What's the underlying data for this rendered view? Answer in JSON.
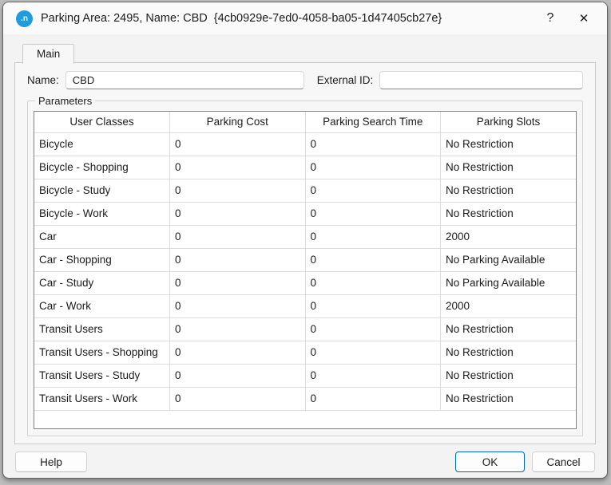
{
  "window": {
    "title": "Parking Area: 2495, Name: CBD  {4cb0929e-7ed0-4058-ba05-1d47405cb27e}",
    "app_icon_text": ".n",
    "help_glyph": "?",
    "close_glyph": "✕"
  },
  "tabs": [
    {
      "label": "Main",
      "active": true
    }
  ],
  "form": {
    "name_label": "Name:",
    "name_value": "CBD",
    "external_id_label": "External ID:",
    "external_id_value": ""
  },
  "parameters": {
    "group_label": "Parameters",
    "table": {
      "columns": [
        "User Classes",
        "Parking Cost",
        "Parking Search Time",
        "Parking Slots"
      ],
      "rows": [
        [
          "Bicycle",
          "0",
          "0",
          "No Restriction"
        ],
        [
          "Bicycle - Shopping",
          "0",
          "0",
          "No Restriction"
        ],
        [
          "Bicycle - Study",
          "0",
          "0",
          "No Restriction"
        ],
        [
          "Bicycle - Work",
          "0",
          "0",
          "No Restriction"
        ],
        [
          "Car",
          "0",
          "0",
          "2000"
        ],
        [
          "Car - Shopping",
          "0",
          "0",
          "No Parking Available"
        ],
        [
          "Car - Study",
          "0",
          "0",
          "No Parking Available"
        ],
        [
          "Car - Work",
          "0",
          "0",
          "2000"
        ],
        [
          "Transit Users",
          "0",
          "0",
          "No Restriction"
        ],
        [
          "Transit Users - Shopping",
          "0",
          "0",
          "No Restriction"
        ],
        [
          "Transit Users - Study",
          "0",
          "0",
          "No Restriction"
        ],
        [
          "Transit Users - Work",
          "0",
          "0",
          "No Restriction"
        ]
      ]
    }
  },
  "buttons": {
    "help": "Help",
    "ok": "OK",
    "cancel": "Cancel"
  },
  "colors": {
    "accent": "#0067c0",
    "icon_bg": "#1e9ce0",
    "grid_line": "#dcdcdc",
    "table_border": "#828282"
  }
}
